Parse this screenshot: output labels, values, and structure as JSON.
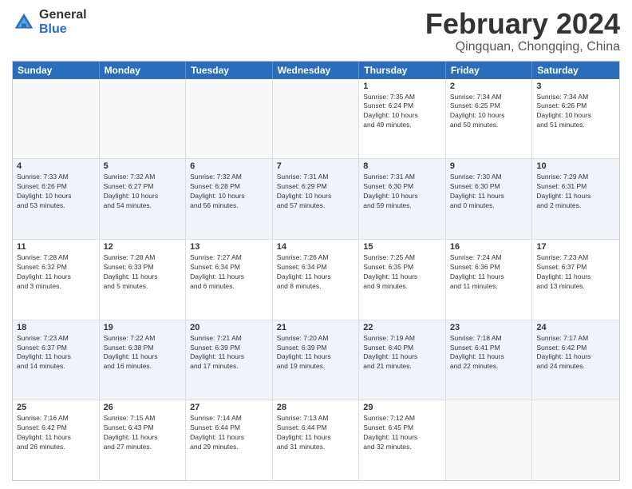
{
  "logo": {
    "general": "General",
    "blue": "Blue"
  },
  "title": "February 2024",
  "location": "Qingquan, Chongqing, China",
  "header_days": [
    "Sunday",
    "Monday",
    "Tuesday",
    "Wednesday",
    "Thursday",
    "Friday",
    "Saturday"
  ],
  "weeks": [
    [
      {
        "day": "",
        "content": ""
      },
      {
        "day": "",
        "content": ""
      },
      {
        "day": "",
        "content": ""
      },
      {
        "day": "",
        "content": ""
      },
      {
        "day": "1",
        "content": "Sunrise: 7:35 AM\nSunset: 6:24 PM\nDaylight: 10 hours\nand 49 minutes."
      },
      {
        "day": "2",
        "content": "Sunrise: 7:34 AM\nSunset: 6:25 PM\nDaylight: 10 hours\nand 50 minutes."
      },
      {
        "day": "3",
        "content": "Sunrise: 7:34 AM\nSunset: 6:26 PM\nDaylight: 10 hours\nand 51 minutes."
      }
    ],
    [
      {
        "day": "4",
        "content": "Sunrise: 7:33 AM\nSunset: 6:26 PM\nDaylight: 10 hours\nand 53 minutes."
      },
      {
        "day": "5",
        "content": "Sunrise: 7:32 AM\nSunset: 6:27 PM\nDaylight: 10 hours\nand 54 minutes."
      },
      {
        "day": "6",
        "content": "Sunrise: 7:32 AM\nSunset: 6:28 PM\nDaylight: 10 hours\nand 56 minutes."
      },
      {
        "day": "7",
        "content": "Sunrise: 7:31 AM\nSunset: 6:29 PM\nDaylight: 10 hours\nand 57 minutes."
      },
      {
        "day": "8",
        "content": "Sunrise: 7:31 AM\nSunset: 6:30 PM\nDaylight: 10 hours\nand 59 minutes."
      },
      {
        "day": "9",
        "content": "Sunrise: 7:30 AM\nSunset: 6:30 PM\nDaylight: 11 hours\nand 0 minutes."
      },
      {
        "day": "10",
        "content": "Sunrise: 7:29 AM\nSunset: 6:31 PM\nDaylight: 11 hours\nand 2 minutes."
      }
    ],
    [
      {
        "day": "11",
        "content": "Sunrise: 7:28 AM\nSunset: 6:32 PM\nDaylight: 11 hours\nand 3 minutes."
      },
      {
        "day": "12",
        "content": "Sunrise: 7:28 AM\nSunset: 6:33 PM\nDaylight: 11 hours\nand 5 minutes."
      },
      {
        "day": "13",
        "content": "Sunrise: 7:27 AM\nSunset: 6:34 PM\nDaylight: 11 hours\nand 6 minutes."
      },
      {
        "day": "14",
        "content": "Sunrise: 7:26 AM\nSunset: 6:34 PM\nDaylight: 11 hours\nand 8 minutes."
      },
      {
        "day": "15",
        "content": "Sunrise: 7:25 AM\nSunset: 6:35 PM\nDaylight: 11 hours\nand 9 minutes."
      },
      {
        "day": "16",
        "content": "Sunrise: 7:24 AM\nSunset: 6:36 PM\nDaylight: 11 hours\nand 11 minutes."
      },
      {
        "day": "17",
        "content": "Sunrise: 7:23 AM\nSunset: 6:37 PM\nDaylight: 11 hours\nand 13 minutes."
      }
    ],
    [
      {
        "day": "18",
        "content": "Sunrise: 7:23 AM\nSunset: 6:37 PM\nDaylight: 11 hours\nand 14 minutes."
      },
      {
        "day": "19",
        "content": "Sunrise: 7:22 AM\nSunset: 6:38 PM\nDaylight: 11 hours\nand 16 minutes."
      },
      {
        "day": "20",
        "content": "Sunrise: 7:21 AM\nSunset: 6:39 PM\nDaylight: 11 hours\nand 17 minutes."
      },
      {
        "day": "21",
        "content": "Sunrise: 7:20 AM\nSunset: 6:39 PM\nDaylight: 11 hours\nand 19 minutes."
      },
      {
        "day": "22",
        "content": "Sunrise: 7:19 AM\nSunset: 6:40 PM\nDaylight: 11 hours\nand 21 minutes."
      },
      {
        "day": "23",
        "content": "Sunrise: 7:18 AM\nSunset: 6:41 PM\nDaylight: 11 hours\nand 22 minutes."
      },
      {
        "day": "24",
        "content": "Sunrise: 7:17 AM\nSunset: 6:42 PM\nDaylight: 11 hours\nand 24 minutes."
      }
    ],
    [
      {
        "day": "25",
        "content": "Sunrise: 7:16 AM\nSunset: 6:42 PM\nDaylight: 11 hours\nand 26 minutes."
      },
      {
        "day": "26",
        "content": "Sunrise: 7:15 AM\nSunset: 6:43 PM\nDaylight: 11 hours\nand 27 minutes."
      },
      {
        "day": "27",
        "content": "Sunrise: 7:14 AM\nSunset: 6:44 PM\nDaylight: 11 hours\nand 29 minutes."
      },
      {
        "day": "28",
        "content": "Sunrise: 7:13 AM\nSunset: 6:44 PM\nDaylight: 11 hours\nand 31 minutes."
      },
      {
        "day": "29",
        "content": "Sunrise: 7:12 AM\nSunset: 6:45 PM\nDaylight: 11 hours\nand 32 minutes."
      },
      {
        "day": "",
        "content": ""
      },
      {
        "day": "",
        "content": ""
      }
    ]
  ]
}
